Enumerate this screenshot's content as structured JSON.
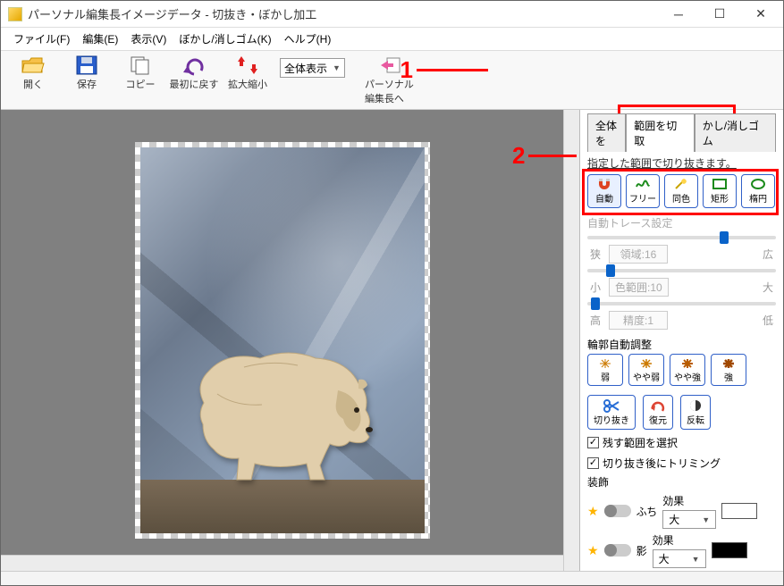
{
  "title": "パーソナル編集長イメージデータ - 切抜き・ぼかし加工",
  "menu": {
    "file": "ファイル(F)",
    "edit": "編集(E)",
    "view": "表示(V)",
    "blur": "ぼかし/消しゴム(K)",
    "help": "ヘルプ(H)"
  },
  "toolbar": {
    "open": "開く",
    "save": "保存",
    "copy": "コピー",
    "undo": "最初に戻す",
    "zoom": "拡大縮小",
    "zoom_value": "全体表示",
    "back": "パーソナル編集長へ"
  },
  "callouts": {
    "one": "1",
    "two": "2"
  },
  "tabs": {
    "whole": "全体を",
    "range": "範囲を切取",
    "eraser": "かし/消しゴム"
  },
  "side": {
    "desc": "指定した範囲で切り抜きます。",
    "tools": {
      "auto": "自動",
      "free": "フリー",
      "same": "同色",
      "rect": "矩形",
      "ellipse": "楕円"
    },
    "auto_trace": "自動トレース設定",
    "area_label": "領域:16",
    "color_label": "色範囲:10",
    "prec_label": "精度:1",
    "narrow": "狭",
    "wide": "広",
    "small": "小",
    "large": "大",
    "high": "高",
    "low": "低",
    "outline": "輪郭自動調整",
    "ol": {
      "weak": "弱",
      "mweak": "やや弱",
      "mstrong": "やや強",
      "strong": "強"
    },
    "act": {
      "cut": "切り抜き",
      "undo": "復元",
      "invert": "反転"
    },
    "chk1": "残す範囲を選択",
    "chk2": "切り抜き後にトリミング",
    "deco": "装飾",
    "edge": "ふち",
    "shadow": "影",
    "effect": "効果",
    "size": "大"
  },
  "colors": {
    "edge_swatch": "#ffffff",
    "shadow_swatch": "#000000"
  }
}
